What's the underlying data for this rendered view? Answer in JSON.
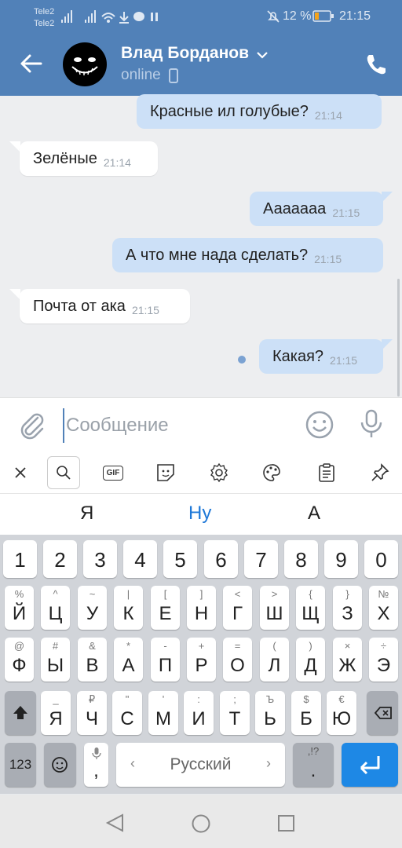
{
  "status_bar": {
    "carrier1": "Tele2",
    "carrier2": "Tele2",
    "battery_text": "12 %",
    "time": "21:15"
  },
  "header": {
    "contact_name": "Влад Борданов",
    "contact_status": "online"
  },
  "messages": [
    {
      "text": "Красные ил голубые?",
      "time": "21:14",
      "dir": "out"
    },
    {
      "text": "Зелёные",
      "time": "21:14",
      "dir": "in"
    },
    {
      "text": "Аааааaa",
      "time": "21:15",
      "dir": "out"
    },
    {
      "text": "А что мне нада сделать?",
      "time": "21:15",
      "dir": "out"
    },
    {
      "text": "Почта от ака",
      "time": "21:15",
      "dir": "in"
    },
    {
      "text": "Какая?",
      "time": "21:15",
      "dir": "out"
    }
  ],
  "composer": {
    "placeholder": "Сообщение"
  },
  "keyboard_toolbar": {
    "gif_label": "GIF"
  },
  "suggestions": [
    {
      "text": "Я",
      "highlight": false
    },
    {
      "text": "Ну",
      "highlight": true
    },
    {
      "text": "А",
      "highlight": false
    }
  ],
  "keyboard": {
    "digits": [
      "1",
      "2",
      "3",
      "4",
      "5",
      "6",
      "7",
      "8",
      "9",
      "0"
    ],
    "row1": [
      {
        "m": "Й",
        "s": "%"
      },
      {
        "m": "Ц",
        "s": "^"
      },
      {
        "m": "У",
        "s": "~"
      },
      {
        "m": "К",
        "s": "|"
      },
      {
        "m": "Е",
        "s": "["
      },
      {
        "m": "Н",
        "s": "]"
      },
      {
        "m": "Г",
        "s": "<"
      },
      {
        "m": "Ш",
        "s": ">"
      },
      {
        "m": "Щ",
        "s": "{"
      },
      {
        "m": "З",
        "s": "}"
      },
      {
        "m": "Х",
        "s": "№"
      }
    ],
    "row2": [
      {
        "m": "Ф",
        "s": "@"
      },
      {
        "m": "Ы",
        "s": "#"
      },
      {
        "m": "В",
        "s": "&"
      },
      {
        "m": "А",
        "s": "*"
      },
      {
        "m": "П",
        "s": "-"
      },
      {
        "m": "Р",
        "s": "+"
      },
      {
        "m": "О",
        "s": "="
      },
      {
        "m": "Л",
        "s": "("
      },
      {
        "m": "Д",
        "s": ")"
      },
      {
        "m": "Ж",
        "s": "×"
      },
      {
        "m": "Э",
        "s": "÷"
      }
    ],
    "row3": [
      {
        "m": "Я",
        "s": "_"
      },
      {
        "m": "Ч",
        "s": "₽"
      },
      {
        "m": "С",
        "s": "\""
      },
      {
        "m": "М",
        "s": "'"
      },
      {
        "m": "И",
        "s": ":"
      },
      {
        "m": "Т",
        "s": ";"
      },
      {
        "m": "Ь",
        "s": "Ъ"
      },
      {
        "m": "Б",
        "s": "$"
      },
      {
        "m": "Ю",
        "s": "€"
      }
    ],
    "sym_label": "123",
    "comma": ",",
    "space_label": "Русский",
    "period": ".",
    "period_sub": ",!?"
  },
  "colors": {
    "header": "#5181b8",
    "outgoing_bubble": "#cce0f7",
    "enter_key": "#1e88e5"
  }
}
